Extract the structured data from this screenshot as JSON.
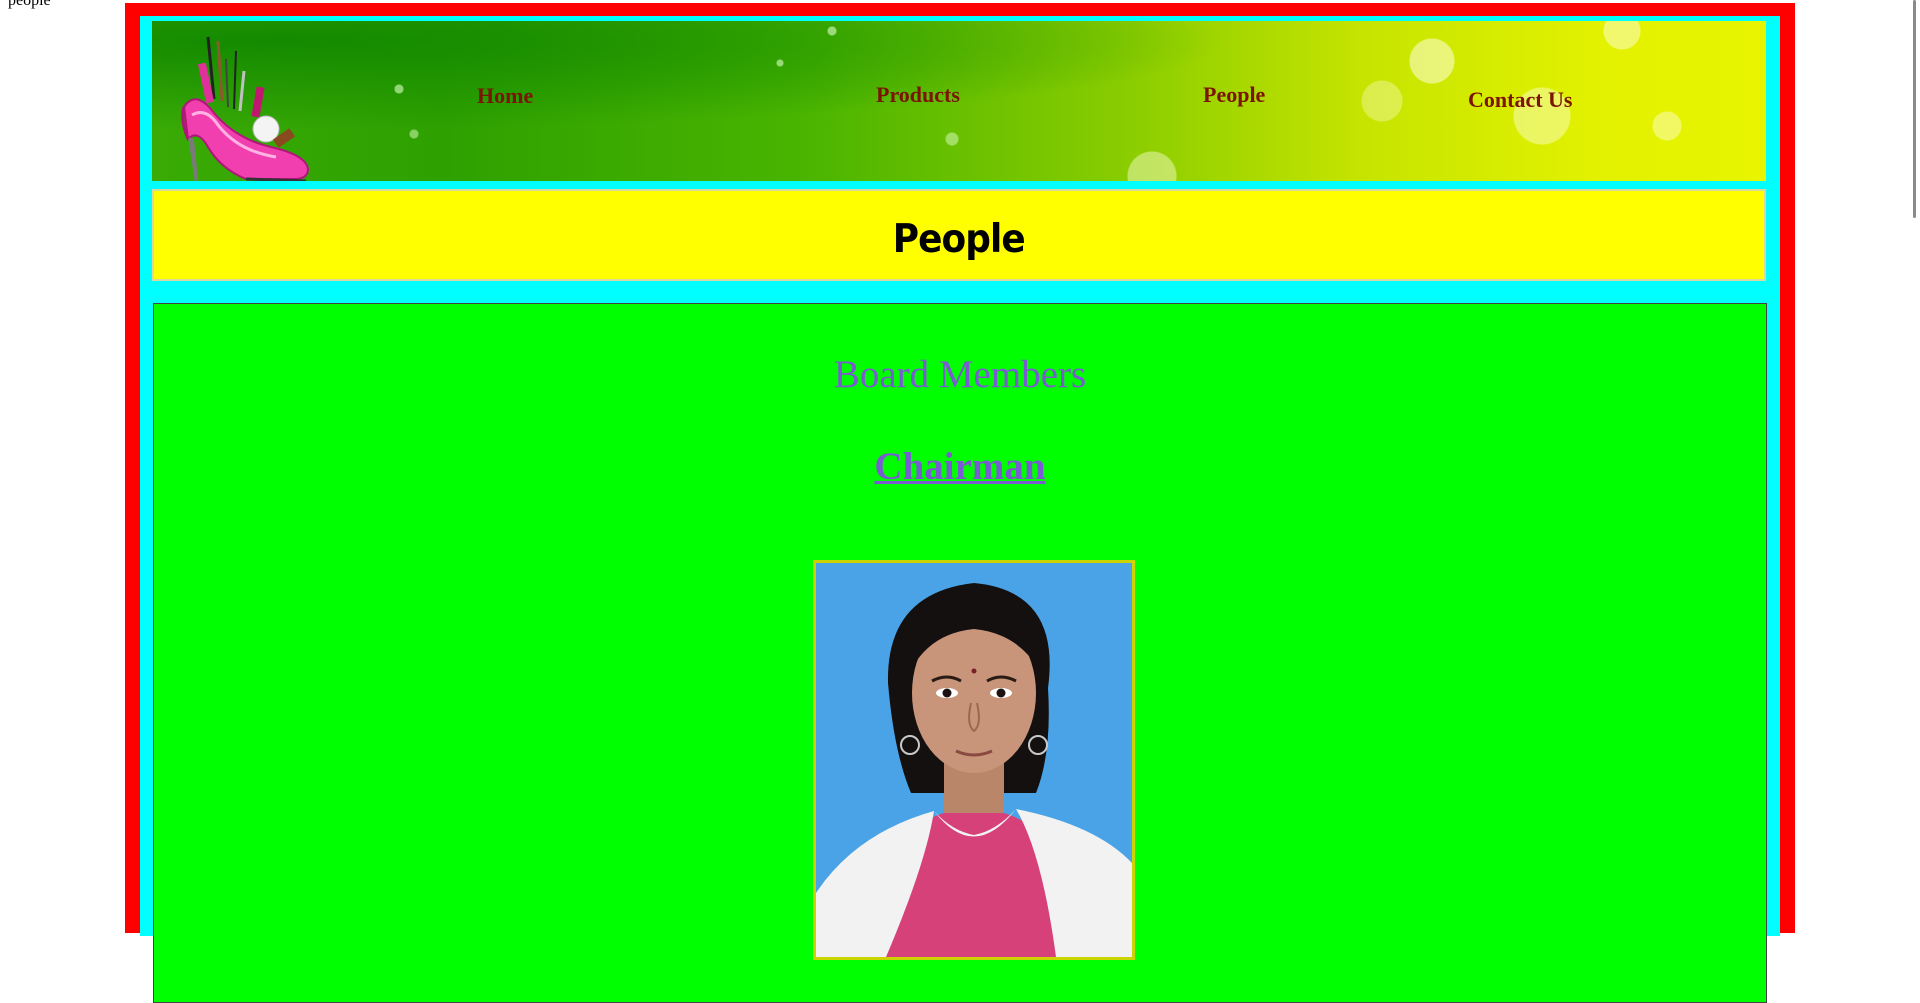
{
  "corner_text": "people",
  "header": {
    "logo_icon": "high-heel-cosmetics-logo",
    "nav": [
      {
        "label": "Home"
      },
      {
        "label": "Products"
      },
      {
        "label": "People"
      },
      {
        "label": "Contact Us"
      }
    ]
  },
  "title_bar": {
    "title": "People"
  },
  "content": {
    "section_heading": "Board Members",
    "role": "Chairman",
    "photo_icon": "chairman-portrait-photo"
  },
  "colors": {
    "frame": "#ff0000",
    "inner": "#00ffff",
    "title_bar": "#ffff00",
    "content_bg": "#00ff00",
    "nav_text": "#7b1400",
    "heading_text": "#7a5cd1"
  }
}
